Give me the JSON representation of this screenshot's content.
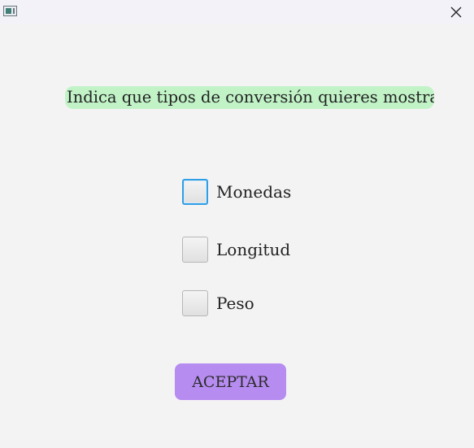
{
  "window": {
    "icon": "app-window-icon",
    "close_icon": "close-x-icon"
  },
  "heading": {
    "text": "Indica que tipos de conversión quieres mostrar",
    "background": "#c1f3c7"
  },
  "options": [
    {
      "label": "Monedas",
      "checked": false,
      "focused": true
    },
    {
      "label": "Longitud",
      "checked": false,
      "focused": false
    },
    {
      "label": "Peso",
      "checked": false,
      "focused": false
    }
  ],
  "accept_button": {
    "label": "ACEPTAR",
    "background": "#b78cf1"
  },
  "colors": {
    "window_background": "#f4f3f4",
    "focus_ring": "#2e9fe6"
  }
}
